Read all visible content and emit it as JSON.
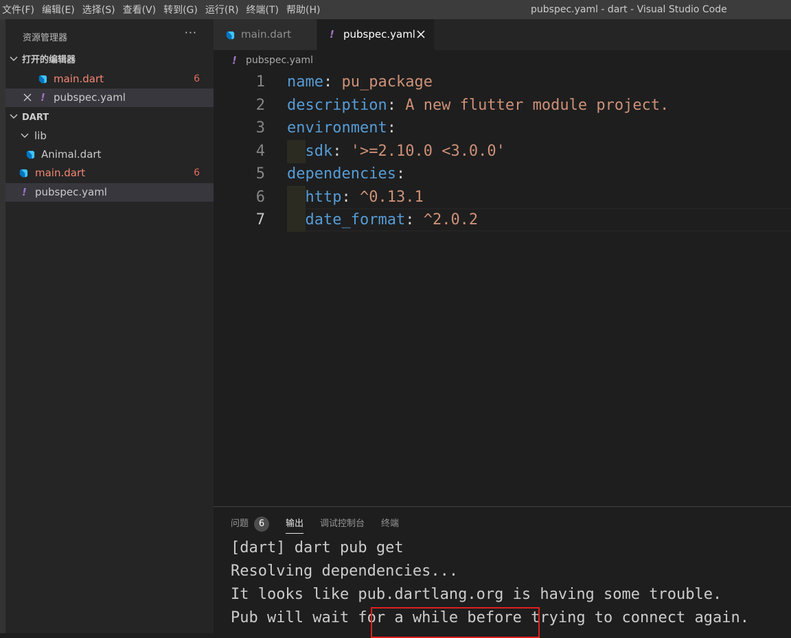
{
  "titlebar": {
    "menu": [
      "文件(F)",
      "编辑(E)",
      "选择(S)",
      "查看(V)",
      "转到(G)",
      "运行(R)",
      "终端(T)",
      "帮助(H)"
    ],
    "window_title": "pubspec.yaml - dart - Visual Studio Code"
  },
  "sidebar": {
    "header": "资源管理器",
    "more": "···",
    "open_editors": {
      "title": "打开的编辑器",
      "items": [
        {
          "label": "main.dart",
          "badge": "6",
          "icon": "dart-icon"
        },
        {
          "label": "pubspec.yaml",
          "icon": "yaml-icon"
        }
      ]
    },
    "workspace": {
      "title": "DART",
      "folder": "lib",
      "items": [
        {
          "label": "Animal.dart",
          "icon": "dart-icon"
        },
        {
          "label": "main.dart",
          "badge": "6",
          "icon": "dart-icon"
        },
        {
          "label": "pubspec.yaml",
          "icon": "yaml-icon"
        }
      ]
    }
  },
  "tabs": [
    {
      "label": "main.dart",
      "icon": "dart-icon"
    },
    {
      "label": "pubspec.yaml",
      "icon": "yaml-icon",
      "active": true
    }
  ],
  "breadcrumb": "pubspec.yaml",
  "editor": {
    "line_numbers": [
      "1",
      "2",
      "3",
      "4",
      "5",
      "6",
      "7"
    ],
    "lines": [
      {
        "key": "name",
        "value": "pu_package"
      },
      {
        "key": "description",
        "value": "A new flutter module project."
      },
      {
        "key": "environment",
        "value": ""
      },
      {
        "key": "sdk",
        "value": "'>=2.10.0 <3.0.0'"
      },
      {
        "key": "dependencies",
        "value": ""
      },
      {
        "key": "http",
        "value": "^0.13.1"
      },
      {
        "key": "date_format",
        "value": "^2.0.2"
      }
    ]
  },
  "panel": {
    "tabs": [
      "问题",
      "输出",
      "调试控制台",
      "终端"
    ],
    "problems_count": "6",
    "output_lines": [
      "[dart] dart pub get",
      "Resolving dependencies...",
      "It looks like pub.dartlang.org is having some trouble.",
      "Pub will wait for a while before trying to connect again."
    ]
  },
  "colors": {
    "key": "#569cd6",
    "string": "#ce9178",
    "error": "#f48771",
    "yaml_icon": "#a074c4",
    "highlight_box": "#e02020"
  }
}
